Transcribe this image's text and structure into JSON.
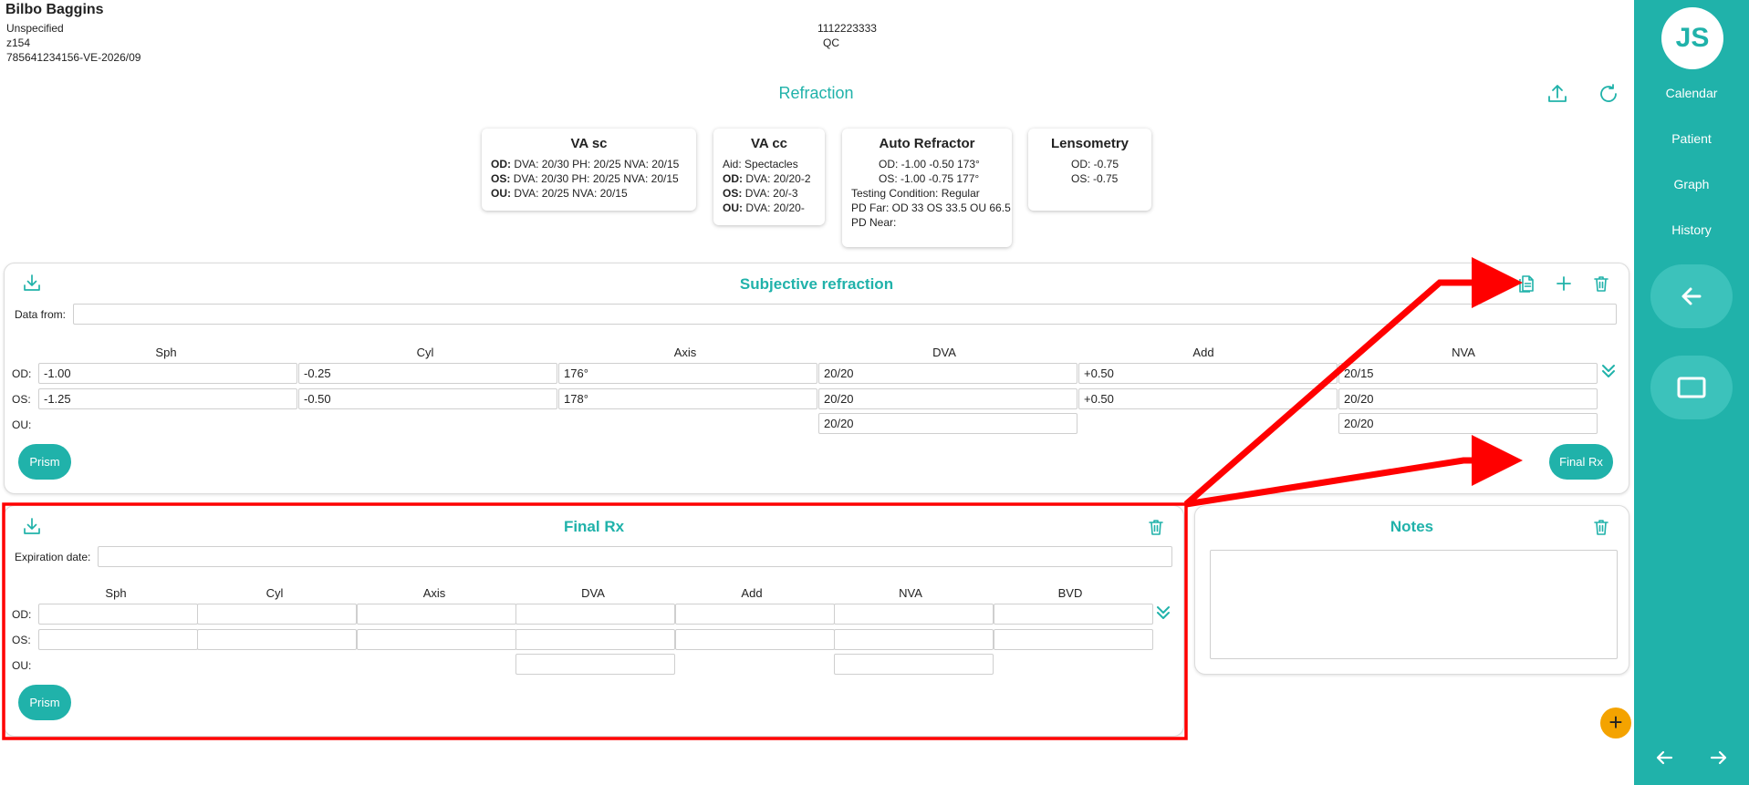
{
  "patient": {
    "name": "Bilbo Baggins",
    "line1": "Unspecified",
    "line2": "z154",
    "line3": "785641234156-VE-2026/09",
    "phone": "1112223333",
    "code": "QC"
  },
  "page_title": "Refraction",
  "summary": {
    "va_sc": {
      "title": "VA sc",
      "rows": [
        {
          "eye": "OD:",
          "text": "DVA: 20/30 PH: 20/25 NVA: 20/15"
        },
        {
          "eye": "OS:",
          "text": "DVA: 20/30 PH: 20/25 NVA: 20/15"
        },
        {
          "eye": "OU:",
          "text": "DVA: 20/25 NVA: 20/15"
        }
      ]
    },
    "va_cc": {
      "title": "VA cc",
      "aid": "Aid: Spectacles",
      "rows": [
        {
          "eye": "OD:",
          "text": "DVA: 20/20-2"
        },
        {
          "eye": "OS:",
          "text": "DVA: 20/-3"
        },
        {
          "eye": "OU:",
          "text": "DVA: 20/20-"
        }
      ]
    },
    "auto_refractor": {
      "title": "Auto Refractor",
      "od": "OD:  -1.00  -0.50  173°",
      "os": "OS:  -1.00  -0.75  177°",
      "condition": "Testing Condition: Regular",
      "pd_far": "PD Far: OD 33 OS 33.5 OU 66.5",
      "pd_near": "PD Near:"
    },
    "lensometry": {
      "title": "Lensometry",
      "od": "OD:  -0.75",
      "os": "OS:  -0.75"
    }
  },
  "subjective": {
    "title": "Subjective refraction",
    "data_from_label": "Data from:",
    "data_from_value": "",
    "columns": [
      "Sph",
      "Cyl",
      "Axis",
      "DVA",
      "Add",
      "NVA"
    ],
    "row_labels": [
      "OD:",
      "OS:",
      "OU:"
    ],
    "od": [
      "-1.00",
      "-0.25",
      "176°",
      "20/20",
      "+0.50",
      "20/15"
    ],
    "os": [
      "-1.25",
      "-0.50",
      "178°",
      "20/20",
      "+0.50",
      "20/20"
    ],
    "ou_dva": "20/20",
    "ou_nva": "20/20",
    "prism_label": "Prism",
    "final_rx_label": "Final Rx"
  },
  "final_rx": {
    "title": "Final Rx",
    "expiration_label": "Expiration date:",
    "expiration_value": "",
    "columns": [
      "Sph",
      "Cyl",
      "Axis",
      "DVA",
      "Add",
      "NVA",
      "BVD"
    ],
    "row_labels": [
      "OD:",
      "OS:",
      "OU:"
    ],
    "prism_label": "Prism"
  },
  "notes": {
    "title": "Notes",
    "value": ""
  },
  "sidebar": {
    "initials": "JS",
    "items": [
      "Calendar",
      "Patient",
      "Graph",
      "History"
    ]
  },
  "colors": {
    "accent": "#20b2aa",
    "sidebar": "#20b2aa",
    "annotation": "#ff0000",
    "fab": "#f4a300"
  },
  "icons": [
    "upload-icon",
    "refresh-icon",
    "download-icon",
    "copy-icon",
    "plus-icon",
    "trash-icon",
    "chevron-double-down-icon",
    "arrow-left-icon",
    "square-icon",
    "arrow-right-icon"
  ]
}
